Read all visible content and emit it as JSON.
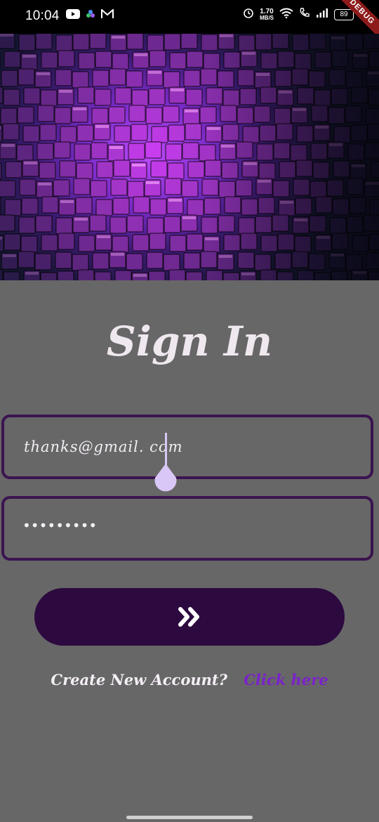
{
  "status_bar": {
    "time": "10:04",
    "net_speed_value": "1.70",
    "net_speed_unit": "MB/S",
    "battery": "89",
    "left_icons": [
      "youtube-icon",
      "app-icon",
      "gmail-icon"
    ],
    "right_icons": [
      "alarm-icon",
      "wifi-icon",
      "call-icon",
      "signal-icon"
    ]
  },
  "debug_banner": "DEBUG",
  "header_image": {
    "icon": "purple-cubes-wall-image"
  },
  "signin": {
    "title": "Sign In",
    "email_value": "thanks@gmail. com",
    "password_mask": "•••••••••",
    "submit_icon": "double-chevron-right-icon"
  },
  "footer": {
    "prompt": "Create New Account?",
    "link": "Click here"
  },
  "colors": {
    "background": "#676767",
    "field_border": "#3b1450",
    "button": "#2c0a3f",
    "link": "#7b22c9",
    "cursor": "#d8c7f7"
  }
}
